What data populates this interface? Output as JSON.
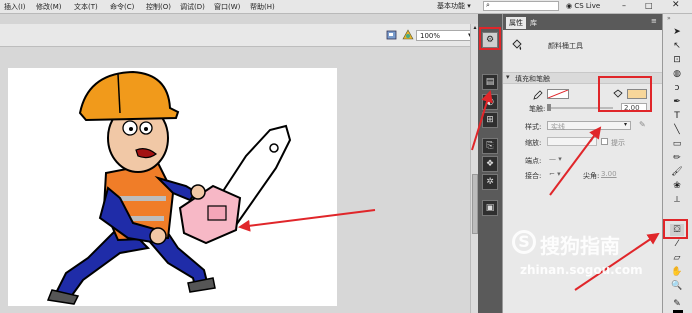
{
  "menu": {
    "items": [
      "插入(I)",
      "修改(M)",
      "文本(T)",
      "命令(C)",
      "控制(O)",
      "调试(D)",
      "窗口(W)",
      "帮助(H)"
    ],
    "workspace": "基本功能",
    "search_placeholder": "",
    "cs_live": "CS Live"
  },
  "stage": {
    "zoom": "100%"
  },
  "properties": {
    "tabs": [
      "属性",
      "库"
    ],
    "tool_name": "颜料桶工具",
    "section": "填充和笔触",
    "stroke_label": "笔触:",
    "stroke_value": "2.00",
    "style_label": "样式:",
    "style_value": "实线",
    "scale_label": "缩放:",
    "hint_label": "提示",
    "cap_label": "端点:",
    "join_label": "接合:",
    "miter_label": "尖角:",
    "miter_value": "3.00"
  },
  "watermark": {
    "brand": "搜狗指南",
    "url": "zhinan.sogou.com"
  },
  "colors": {
    "annotation_red": "#e0262a",
    "fill_swatch": "#f7d69a"
  }
}
